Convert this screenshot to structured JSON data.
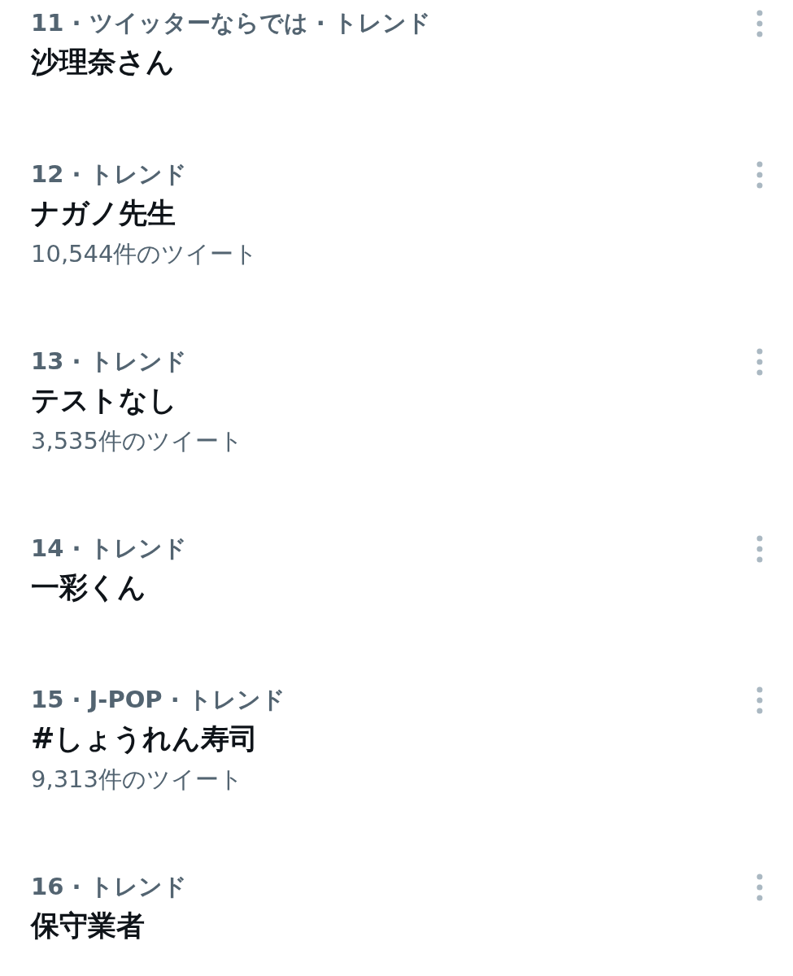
{
  "trends": [
    {
      "context": "11 · ツイッターならでは · トレンド",
      "title": "沙理奈さん"
    },
    {
      "context": "12 · トレンド",
      "title": "ナガノ先生",
      "count": "10,544件のツイート"
    },
    {
      "context": "13 · トレンド",
      "title": "テストなし",
      "count": "3,535件のツイート"
    },
    {
      "context": "14 · トレンド",
      "title": "一彩くん"
    },
    {
      "context": "15 · J-POP · トレンド",
      "title": "#しょうれん寿司",
      "count": "9,313件のツイート"
    },
    {
      "context": "16 · トレンド",
      "title": "保守業者"
    }
  ]
}
